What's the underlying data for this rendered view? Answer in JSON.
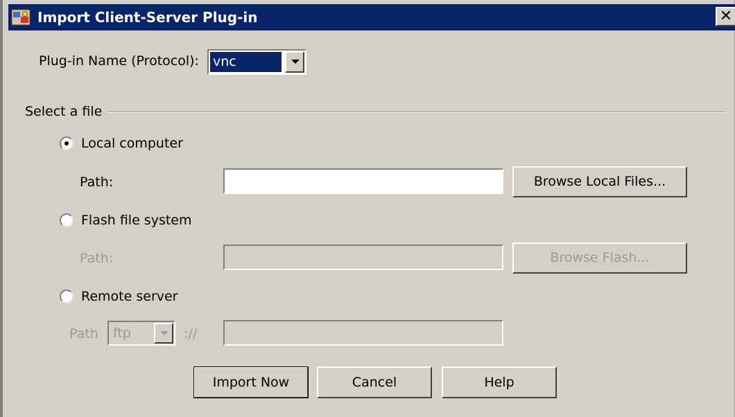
{
  "window": {
    "title": "Import Client-Server Plug-in",
    "close_label": "✕"
  },
  "plugin": {
    "label": "Plug-in Name (Protocol):",
    "selected": "vnc"
  },
  "file_section": {
    "title": "Select a file"
  },
  "local": {
    "option_label": "Local computer",
    "checked": true,
    "path_label": "Path:",
    "path_value": "",
    "browse_label": "Browse Local Files..."
  },
  "flash": {
    "option_label": "Flash file system",
    "checked": false,
    "path_label": "Path:",
    "path_value": "",
    "browse_label": "Browse Flash..."
  },
  "remote": {
    "option_label": "Remote server",
    "checked": false,
    "path_label": "Path",
    "protocol": "ftp",
    "separator": "://",
    "path_value": ""
  },
  "actions": {
    "import_label": "Import Now",
    "cancel_label": "Cancel",
    "help_label": "Help"
  },
  "colors": {
    "titlebar": "#0a246a",
    "window_bg": "#d4d0c8",
    "disabled_text": "#9c9a94"
  }
}
